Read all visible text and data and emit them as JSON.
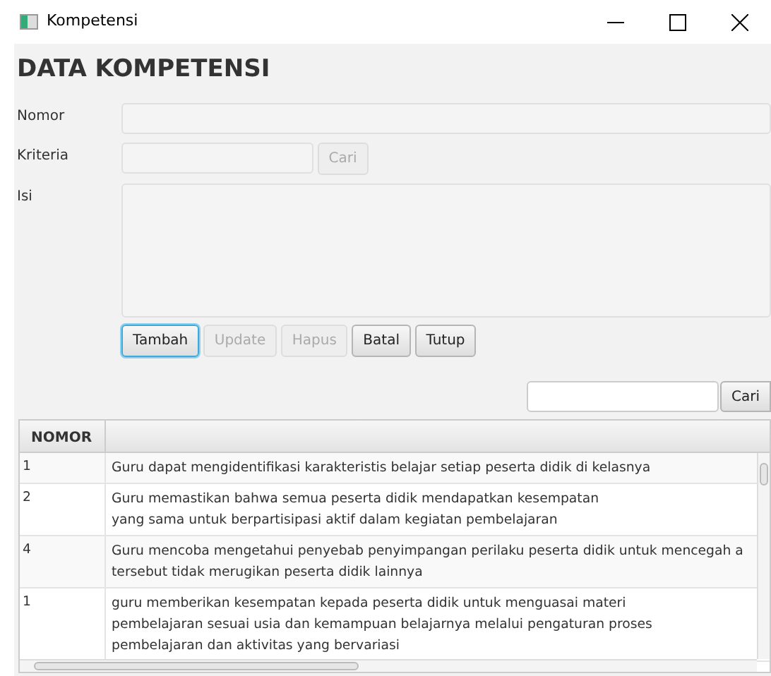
{
  "window": {
    "title": "Kompetensi"
  },
  "heading": "DATA KOMPETENSI",
  "form": [
    {
      "kind": "text",
      "label": "Nomor"
    },
    {
      "kind": "search",
      "label": "Kriteria",
      "button": {
        "label": "Cari",
        "disabled": true
      }
    },
    {
      "kind": "area",
      "label": "Isi"
    }
  ],
  "buttons": [
    {
      "label": "Tambah",
      "disabled": false,
      "focused": true
    },
    {
      "label": "Update",
      "disabled": true,
      "focused": false
    },
    {
      "label": "Hapus",
      "disabled": true,
      "focused": false
    },
    {
      "label": "Batal",
      "disabled": false,
      "focused": false
    },
    {
      "label": "Tutup",
      "disabled": false,
      "focused": false
    }
  ],
  "table_search": {
    "button": "Cari"
  },
  "table": {
    "columns": [
      "NOMOR"
    ],
    "rows": [
      {
        "nomor": "1",
        "lines": [
          "Guru dapat mengidentifikasi karakteristis belajar setiap peserta didik di kelasnya"
        ]
      },
      {
        "nomor": "2",
        "lines": [
          "Guru memastikan bahwa semua peserta didik mendapatkan kesempatan",
          "yang sama untuk berpartisipasi aktif  dalam kegiatan pembelajaran"
        ]
      },
      {
        "nomor": "4",
        "lines": [
          "Guru mencoba mengetahui penyebab penyimpangan perilaku peserta didik untuk mencegah a",
          "tersebut tidak merugikan peserta didik lainnya"
        ]
      },
      {
        "nomor": "1",
        "lines": [
          "guru memberikan kesempatan kepada peserta didik untuk menguasai materi",
          "pembelajaran sesuai usia dan kemampuan belajarnya melalui pengaturan proses",
          "pembelajaran dan aktivitas yang bervariasi"
        ]
      }
    ]
  }
}
